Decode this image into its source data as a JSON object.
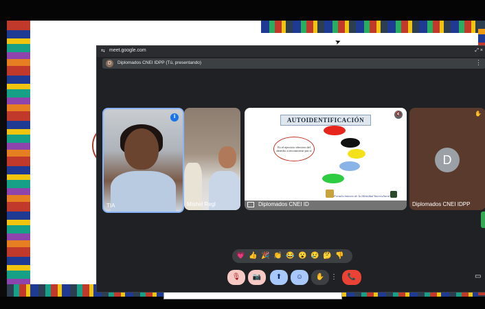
{
  "browser": {
    "url": "meet.google.com",
    "window_controls": "⤢ ×"
  },
  "presenting_notice": {
    "avatar_letter": "D",
    "text": "Diplomados CNEI IDPP (Tú, presentando)",
    "more": "⋮"
  },
  "participants": [
    {
      "name": "TIA",
      "status": "speaking"
    },
    {
      "name": "Mishel Regl"
    },
    {
      "name": "Diplomados CNEI ID",
      "status": "presenting"
    },
    {
      "name": "Diplomados CNEI IDPP",
      "avatar_letter": "D",
      "status": "hand-raised"
    }
  ],
  "slide": {
    "title": "AUTOIDENTIFICACIÓN",
    "ellipse_text": "Es el ejercicio efectivo del derecho a reconocerse por sí",
    "script": "Fortalecimiento de la Identidad Intercultural"
  },
  "reactions": [
    "💗",
    "👍",
    "🎉",
    "👏",
    "😂",
    "😮",
    "😢",
    "🤔",
    "👎"
  ],
  "controls": {
    "mic": "🎙",
    "camera": "📷",
    "share": "⬆",
    "emoji": "☺",
    "hand": "✋",
    "more": "⋮",
    "end_call": "📞"
  },
  "colors": {
    "speaking_border": "#8ab4f8",
    "end_call": "#ea4335",
    "muted_bg": "#f6c9c5"
  }
}
